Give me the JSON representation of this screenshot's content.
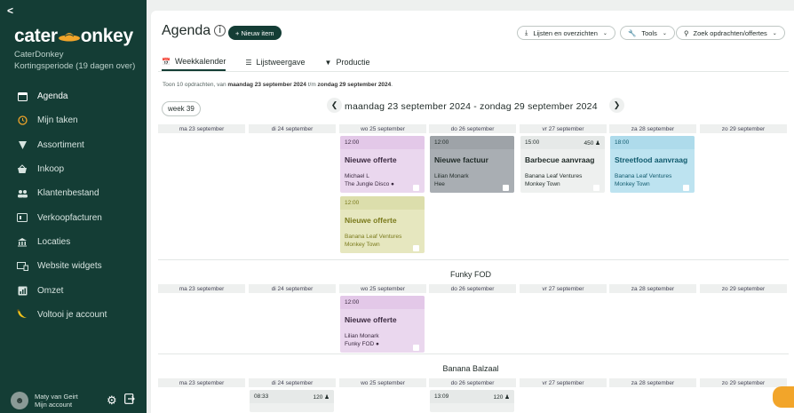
{
  "sidebar": {
    "back": "<",
    "logo_left": "cater",
    "logo_right": "onkey",
    "org_name": "CaterDonkey",
    "org_period": "Kortingsperiode (19 dagen over)",
    "items": [
      {
        "label": "Agenda",
        "icon": "calendar-icon"
      },
      {
        "label": "Mijn taken",
        "icon": "clock-icon"
      },
      {
        "label": "Assortiment",
        "icon": "tag-icon"
      },
      {
        "label": "Inkoop",
        "icon": "basket-icon"
      },
      {
        "label": "Klantenbestand",
        "icon": "users-icon"
      },
      {
        "label": "Verkoopfacturen",
        "icon": "invoice-icon"
      },
      {
        "label": "Locaties",
        "icon": "building-icon"
      },
      {
        "label": "Website widgets",
        "icon": "widget-icon"
      },
      {
        "label": "Omzet",
        "icon": "chart-icon"
      },
      {
        "label": "Voltooi je account",
        "icon": "banana-icon"
      }
    ],
    "user_name": "Maty van Geirt",
    "user_account": "Mijn account"
  },
  "header": {
    "title": "Agenda",
    "new_button": "+ Nieuw item",
    "lists_button": "Lijsten en overzichten",
    "tools_button": "Tools",
    "search_button": "Zoek opdrachten/offertes"
  },
  "tabs": [
    "Weekkalender",
    "Lijstweergave",
    "Productie"
  ],
  "summary_pre": "Toon 10 opdrachten, van ",
  "summary_from": "maandag 23 september 2024",
  "summary_mid": " t/m ",
  "summary_to": "zondag 29 september 2024",
  "summary_post": ".",
  "week_label": "week 39",
  "range_label": "maandag 23 september 2024 - zondag 29 september 2024",
  "days": [
    "ma 23 september",
    "di 24 september",
    "wo 25 september",
    "do 26 september",
    "vr 27 september",
    "za 28 september",
    "zo 29 september"
  ],
  "groups": [
    {
      "title": "",
      "cards": [
        {
          "day": 2,
          "row": 0,
          "time": "12:00",
          "count": "",
          "title": "Nieuwe offerte",
          "sub1": "Michael L",
          "sub2": "The Jungle Disco",
          "pin": true,
          "bg": "#ead7ee",
          "head": "#e3c8e8",
          "fg": "#3b2a40"
        },
        {
          "day": 3,
          "row": 0,
          "time": "12:00",
          "count": "",
          "title": "Nieuwe factuur",
          "sub1": "Lilian Monark",
          "sub2": "Hee",
          "pin": false,
          "bg": "#a9aeb3",
          "head": "#9ea3a8",
          "fg": "#1f2a27"
        },
        {
          "day": 4,
          "row": 0,
          "time": "15:00",
          "count": "450",
          "title": "Barbecue aanvraag",
          "sub1": "Banana Leaf Ventures",
          "sub2": "Monkey Town",
          "pin": false,
          "bg": "#eef0ef",
          "head": "#e6e9e8",
          "fg": "#1f2a27"
        },
        {
          "day": 5,
          "row": 0,
          "time": "18:00",
          "count": "",
          "title": "Streetfood aanvraag",
          "sub1": "Banana Leaf Ventures",
          "sub2": "Monkey Town",
          "pin": false,
          "bg": "#bde3f0",
          "head": "#aedbeb",
          "fg": "#105a6d"
        },
        {
          "day": 2,
          "row": 1,
          "time": "12:00",
          "count": "",
          "title": "Nieuwe offerte",
          "sub1": "Banana Leaf Ventures",
          "sub2": "Monkey Town",
          "pin": false,
          "bg": "#e6e7bf",
          "head": "#dcdeac",
          "fg": "#7a7a1c"
        }
      ]
    },
    {
      "title": "Funky FOD",
      "cards": [
        {
          "day": 2,
          "row": 0,
          "time": "12:00",
          "count": "",
          "title": "Nieuwe offerte",
          "sub1": "Lilian Monark",
          "sub2": "Funky FOD",
          "pin": true,
          "bg": "#ead7ee",
          "head": "#e3c8e8",
          "fg": "#3b2a40"
        }
      ]
    },
    {
      "title": "Banana Balzaal",
      "cards": [
        {
          "day": 1,
          "row": 0,
          "time": "08:33",
          "count": "120",
          "title": "",
          "sub1": "",
          "sub2": "",
          "pin": false,
          "bg": "#eef0ef",
          "head": "#e6e9e8",
          "fg": "#1f2a27"
        },
        {
          "day": 3,
          "row": 0,
          "time": "13:09",
          "count": "120",
          "title": "",
          "sub1": "",
          "sub2": "",
          "pin": false,
          "bg": "#eef0ef",
          "head": "#e6e9e8",
          "fg": "#1f2a27"
        }
      ]
    }
  ]
}
